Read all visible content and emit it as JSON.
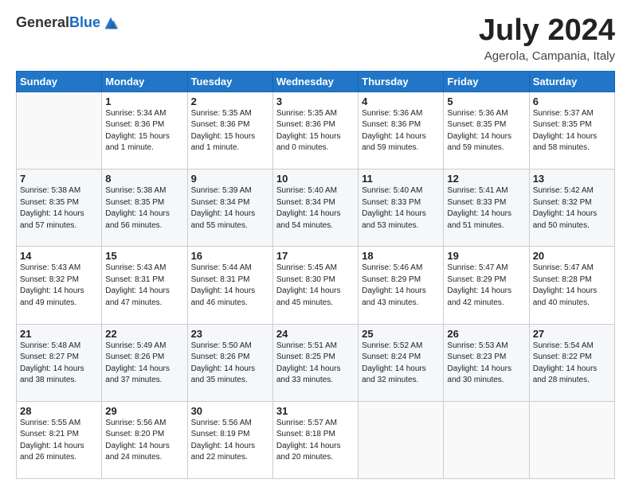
{
  "header": {
    "logo_line1": "General",
    "logo_line2": "Blue",
    "title": "July 2024",
    "subtitle": "Agerola, Campania, Italy"
  },
  "weekdays": [
    "Sunday",
    "Monday",
    "Tuesday",
    "Wednesday",
    "Thursday",
    "Friday",
    "Saturday"
  ],
  "weeks": [
    [
      {
        "day": "",
        "sunrise": "",
        "sunset": "",
        "daylight": ""
      },
      {
        "day": "1",
        "sunrise": "Sunrise: 5:34 AM",
        "sunset": "Sunset: 8:36 PM",
        "daylight": "Daylight: 15 hours and 1 minute."
      },
      {
        "day": "2",
        "sunrise": "Sunrise: 5:35 AM",
        "sunset": "Sunset: 8:36 PM",
        "daylight": "Daylight: 15 hours and 1 minute."
      },
      {
        "day": "3",
        "sunrise": "Sunrise: 5:35 AM",
        "sunset": "Sunset: 8:36 PM",
        "daylight": "Daylight: 15 hours and 0 minutes."
      },
      {
        "day": "4",
        "sunrise": "Sunrise: 5:36 AM",
        "sunset": "Sunset: 8:36 PM",
        "daylight": "Daylight: 14 hours and 59 minutes."
      },
      {
        "day": "5",
        "sunrise": "Sunrise: 5:36 AM",
        "sunset": "Sunset: 8:35 PM",
        "daylight": "Daylight: 14 hours and 59 minutes."
      },
      {
        "day": "6",
        "sunrise": "Sunrise: 5:37 AM",
        "sunset": "Sunset: 8:35 PM",
        "daylight": "Daylight: 14 hours and 58 minutes."
      }
    ],
    [
      {
        "day": "7",
        "sunrise": "Sunrise: 5:38 AM",
        "sunset": "Sunset: 8:35 PM",
        "daylight": "Daylight: 14 hours and 57 minutes."
      },
      {
        "day": "8",
        "sunrise": "Sunrise: 5:38 AM",
        "sunset": "Sunset: 8:35 PM",
        "daylight": "Daylight: 14 hours and 56 minutes."
      },
      {
        "day": "9",
        "sunrise": "Sunrise: 5:39 AM",
        "sunset": "Sunset: 8:34 PM",
        "daylight": "Daylight: 14 hours and 55 minutes."
      },
      {
        "day": "10",
        "sunrise": "Sunrise: 5:40 AM",
        "sunset": "Sunset: 8:34 PM",
        "daylight": "Daylight: 14 hours and 54 minutes."
      },
      {
        "day": "11",
        "sunrise": "Sunrise: 5:40 AM",
        "sunset": "Sunset: 8:33 PM",
        "daylight": "Daylight: 14 hours and 53 minutes."
      },
      {
        "day": "12",
        "sunrise": "Sunrise: 5:41 AM",
        "sunset": "Sunset: 8:33 PM",
        "daylight": "Daylight: 14 hours and 51 minutes."
      },
      {
        "day": "13",
        "sunrise": "Sunrise: 5:42 AM",
        "sunset": "Sunset: 8:32 PM",
        "daylight": "Daylight: 14 hours and 50 minutes."
      }
    ],
    [
      {
        "day": "14",
        "sunrise": "Sunrise: 5:43 AM",
        "sunset": "Sunset: 8:32 PM",
        "daylight": "Daylight: 14 hours and 49 minutes."
      },
      {
        "day": "15",
        "sunrise": "Sunrise: 5:43 AM",
        "sunset": "Sunset: 8:31 PM",
        "daylight": "Daylight: 14 hours and 47 minutes."
      },
      {
        "day": "16",
        "sunrise": "Sunrise: 5:44 AM",
        "sunset": "Sunset: 8:31 PM",
        "daylight": "Daylight: 14 hours and 46 minutes."
      },
      {
        "day": "17",
        "sunrise": "Sunrise: 5:45 AM",
        "sunset": "Sunset: 8:30 PM",
        "daylight": "Daylight: 14 hours and 45 minutes."
      },
      {
        "day": "18",
        "sunrise": "Sunrise: 5:46 AM",
        "sunset": "Sunset: 8:29 PM",
        "daylight": "Daylight: 14 hours and 43 minutes."
      },
      {
        "day": "19",
        "sunrise": "Sunrise: 5:47 AM",
        "sunset": "Sunset: 8:29 PM",
        "daylight": "Daylight: 14 hours and 42 minutes."
      },
      {
        "day": "20",
        "sunrise": "Sunrise: 5:47 AM",
        "sunset": "Sunset: 8:28 PM",
        "daylight": "Daylight: 14 hours and 40 minutes."
      }
    ],
    [
      {
        "day": "21",
        "sunrise": "Sunrise: 5:48 AM",
        "sunset": "Sunset: 8:27 PM",
        "daylight": "Daylight: 14 hours and 38 minutes."
      },
      {
        "day": "22",
        "sunrise": "Sunrise: 5:49 AM",
        "sunset": "Sunset: 8:26 PM",
        "daylight": "Daylight: 14 hours and 37 minutes."
      },
      {
        "day": "23",
        "sunrise": "Sunrise: 5:50 AM",
        "sunset": "Sunset: 8:26 PM",
        "daylight": "Daylight: 14 hours and 35 minutes."
      },
      {
        "day": "24",
        "sunrise": "Sunrise: 5:51 AM",
        "sunset": "Sunset: 8:25 PM",
        "daylight": "Daylight: 14 hours and 33 minutes."
      },
      {
        "day": "25",
        "sunrise": "Sunrise: 5:52 AM",
        "sunset": "Sunset: 8:24 PM",
        "daylight": "Daylight: 14 hours and 32 minutes."
      },
      {
        "day": "26",
        "sunrise": "Sunrise: 5:53 AM",
        "sunset": "Sunset: 8:23 PM",
        "daylight": "Daylight: 14 hours and 30 minutes."
      },
      {
        "day": "27",
        "sunrise": "Sunrise: 5:54 AM",
        "sunset": "Sunset: 8:22 PM",
        "daylight": "Daylight: 14 hours and 28 minutes."
      }
    ],
    [
      {
        "day": "28",
        "sunrise": "Sunrise: 5:55 AM",
        "sunset": "Sunset: 8:21 PM",
        "daylight": "Daylight: 14 hours and 26 minutes."
      },
      {
        "day": "29",
        "sunrise": "Sunrise: 5:56 AM",
        "sunset": "Sunset: 8:20 PM",
        "daylight": "Daylight: 14 hours and 24 minutes."
      },
      {
        "day": "30",
        "sunrise": "Sunrise: 5:56 AM",
        "sunset": "Sunset: 8:19 PM",
        "daylight": "Daylight: 14 hours and 22 minutes."
      },
      {
        "day": "31",
        "sunrise": "Sunrise: 5:57 AM",
        "sunset": "Sunset: 8:18 PM",
        "daylight": "Daylight: 14 hours and 20 minutes."
      },
      {
        "day": "",
        "sunrise": "",
        "sunset": "",
        "daylight": ""
      },
      {
        "day": "",
        "sunrise": "",
        "sunset": "",
        "daylight": ""
      },
      {
        "day": "",
        "sunrise": "",
        "sunset": "",
        "daylight": ""
      }
    ]
  ]
}
